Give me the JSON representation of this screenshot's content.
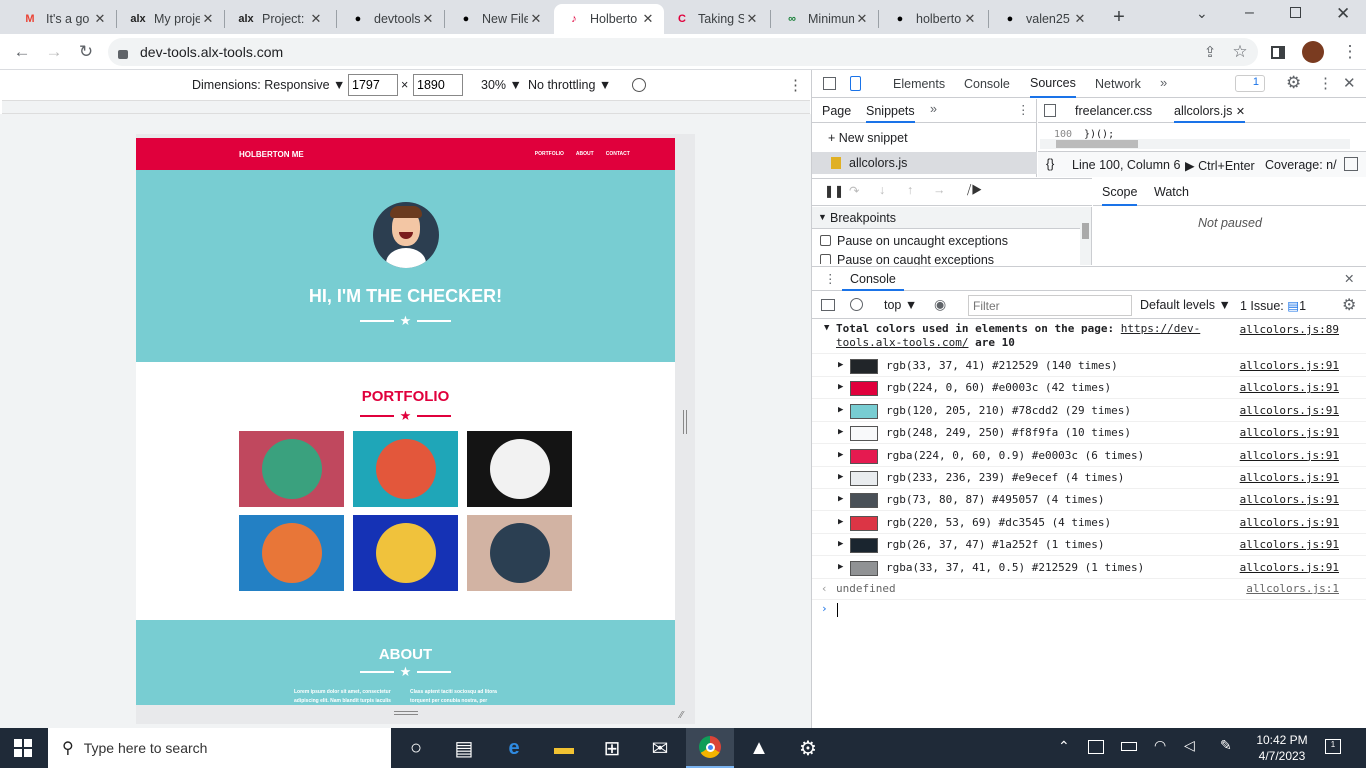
{
  "browser": {
    "tabs": [
      {
        "title": "It's a go",
        "icon": "gmail-icon",
        "color": "#ea4335",
        "glyph": "M"
      },
      {
        "title": "My proje",
        "icon": "alx-icon",
        "color": "#222",
        "glyph": "alx"
      },
      {
        "title": "Project: I",
        "icon": "alx-icon",
        "color": "#222",
        "glyph": "alx"
      },
      {
        "title": "devtools",
        "icon": "github-icon",
        "color": "#000",
        "glyph": "●"
      },
      {
        "title": "New File",
        "icon": "github-icon",
        "color": "#000",
        "glyph": "●"
      },
      {
        "title": "Holberto",
        "icon": "holberton-icon",
        "color": "#e0003c",
        "glyph": "♪"
      },
      {
        "title": "Taking S",
        "icon": "c-icon",
        "color": "#e0003c",
        "glyph": "C"
      },
      {
        "title": "Minimum",
        "icon": "link-icon",
        "color": "#188038",
        "glyph": "∞"
      },
      {
        "title": "holberto",
        "icon": "github-icon",
        "color": "#000",
        "glyph": "●"
      },
      {
        "title": "valen25",
        "icon": "github-icon",
        "color": "#000",
        "glyph": "●"
      }
    ],
    "active_tab": 5,
    "url": "dev-tools.alx-tools.com"
  },
  "device_toolbar": {
    "dimensions_label": "Dimensions: Responsive ▼",
    "width": "1797",
    "times": "×",
    "height": "1890",
    "zoom": "30% ▼",
    "throttle": "No throttling ▼"
  },
  "site": {
    "brand": "HOLBERTON ME",
    "nav": [
      "PORTFOLIO",
      "ABOUT",
      "CONTACT"
    ],
    "hero_title": "HI, I'M THE CHECKER!",
    "portfolio_title": "PORTFOLIO",
    "about_title": "ABOUT",
    "about_left": "Lorem ipsum dolor sit amet, consectetur adipiscing elit. Nam blandit turpis iaculis",
    "about_right": "Class aptent taciti sociosqu ad litora torquent per conubia nostra, per",
    "tiles": [
      {
        "bg": "#c0485e",
        "circle": "#3aa17e",
        "icon": "cabin-icon"
      },
      {
        "bg": "#1fa6b8",
        "circle": "#e3573b",
        "icon": "cake-icon"
      },
      {
        "bg": "#141414",
        "circle": "#f2f2f2",
        "icon": "circus-tent-icon"
      },
      {
        "bg": "#2380c4",
        "circle": "#e87638",
        "icon": "gamepad-icon"
      },
      {
        "bg": "#1532b5",
        "circle": "#f0c23c",
        "icon": "safe-icon"
      },
      {
        "bg": "#d2b3a3",
        "circle": "#2b3f52",
        "icon": "submarine-icon"
      }
    ]
  },
  "devtools": {
    "main_tabs": [
      "Elements",
      "Console",
      "Sources",
      "Network"
    ],
    "selected_main": "Sources",
    "issues_badge": "1",
    "nav_tabs": [
      "Page",
      "Snippets"
    ],
    "selected_nav": "Snippets",
    "new_snippet": "+ New snippet",
    "snippet": "allcolors.js",
    "editor_tabs": [
      "freelancer.css",
      "allcolors.js"
    ],
    "code_line_no": "100",
    "code_text": "})();",
    "status_position": "Line 100, Column 6",
    "run_hint": "▶ Ctrl+Enter",
    "coverage": "Coverage: n/",
    "scope_tabs": [
      "Scope",
      "Watch"
    ],
    "not_paused": "Not paused",
    "breakpoints_label": "Breakpoints",
    "pause_uncaught": "Pause on uncaught exceptions",
    "pause_caught": "Pause on caught exceptions",
    "drawer_title": "Console",
    "context": "top",
    "filter_placeholder": "Filter",
    "levels": "Default levels ▼",
    "issue_count": "1 Issue:",
    "issue_badge": "1",
    "summary_text": "Total colors used in elements on the page: ",
    "summary_link": "https://dev-tools.alx-tools.com/",
    "summary_tail": " are 10",
    "summary_src": "allcolors.js:89",
    "colors": [
      {
        "swatch": "#212529",
        "text": "rgb(33, 37, 41) #212529 (140 times)"
      },
      {
        "swatch": "#e0003c",
        "text": "rgb(224, 0, 60) #e0003c (42 times)"
      },
      {
        "swatch": "#78cdd2",
        "text": "rgb(120, 205, 210) #78cdd2 (29 times)"
      },
      {
        "swatch": "#f8f9fa",
        "text": "rgb(248, 249, 250) #f8f9fa (10 times)"
      },
      {
        "swatch": "#e51a50",
        "text": "rgba(224, 0, 60, 0.9) #e0003c (6 times)"
      },
      {
        "swatch": "#e9ecef",
        "text": "rgb(233, 236, 239) #e9ecef (4 times)"
      },
      {
        "swatch": "#495057",
        "text": "rgb(73, 80, 87) #495057 (4 times)"
      },
      {
        "swatch": "#dc3545",
        "text": "rgb(220, 53, 69) #dc3545 (4 times)"
      },
      {
        "swatch": "#1a252f",
        "text": "rgb(26, 37, 47) #1a252f (1 times)"
      },
      {
        "swatch": "#909294",
        "text": "rgba(33, 37, 41, 0.5) #212529 (1 times)"
      }
    ],
    "colors_src": "allcolors.js:91",
    "undefined_text": "undefined",
    "undefined_src": "allcolors.js:1"
  },
  "taskbar": {
    "search_placeholder": "Type here to search",
    "time": "10:42 PM",
    "date": "4/7/2023",
    "notification_count": "1"
  }
}
